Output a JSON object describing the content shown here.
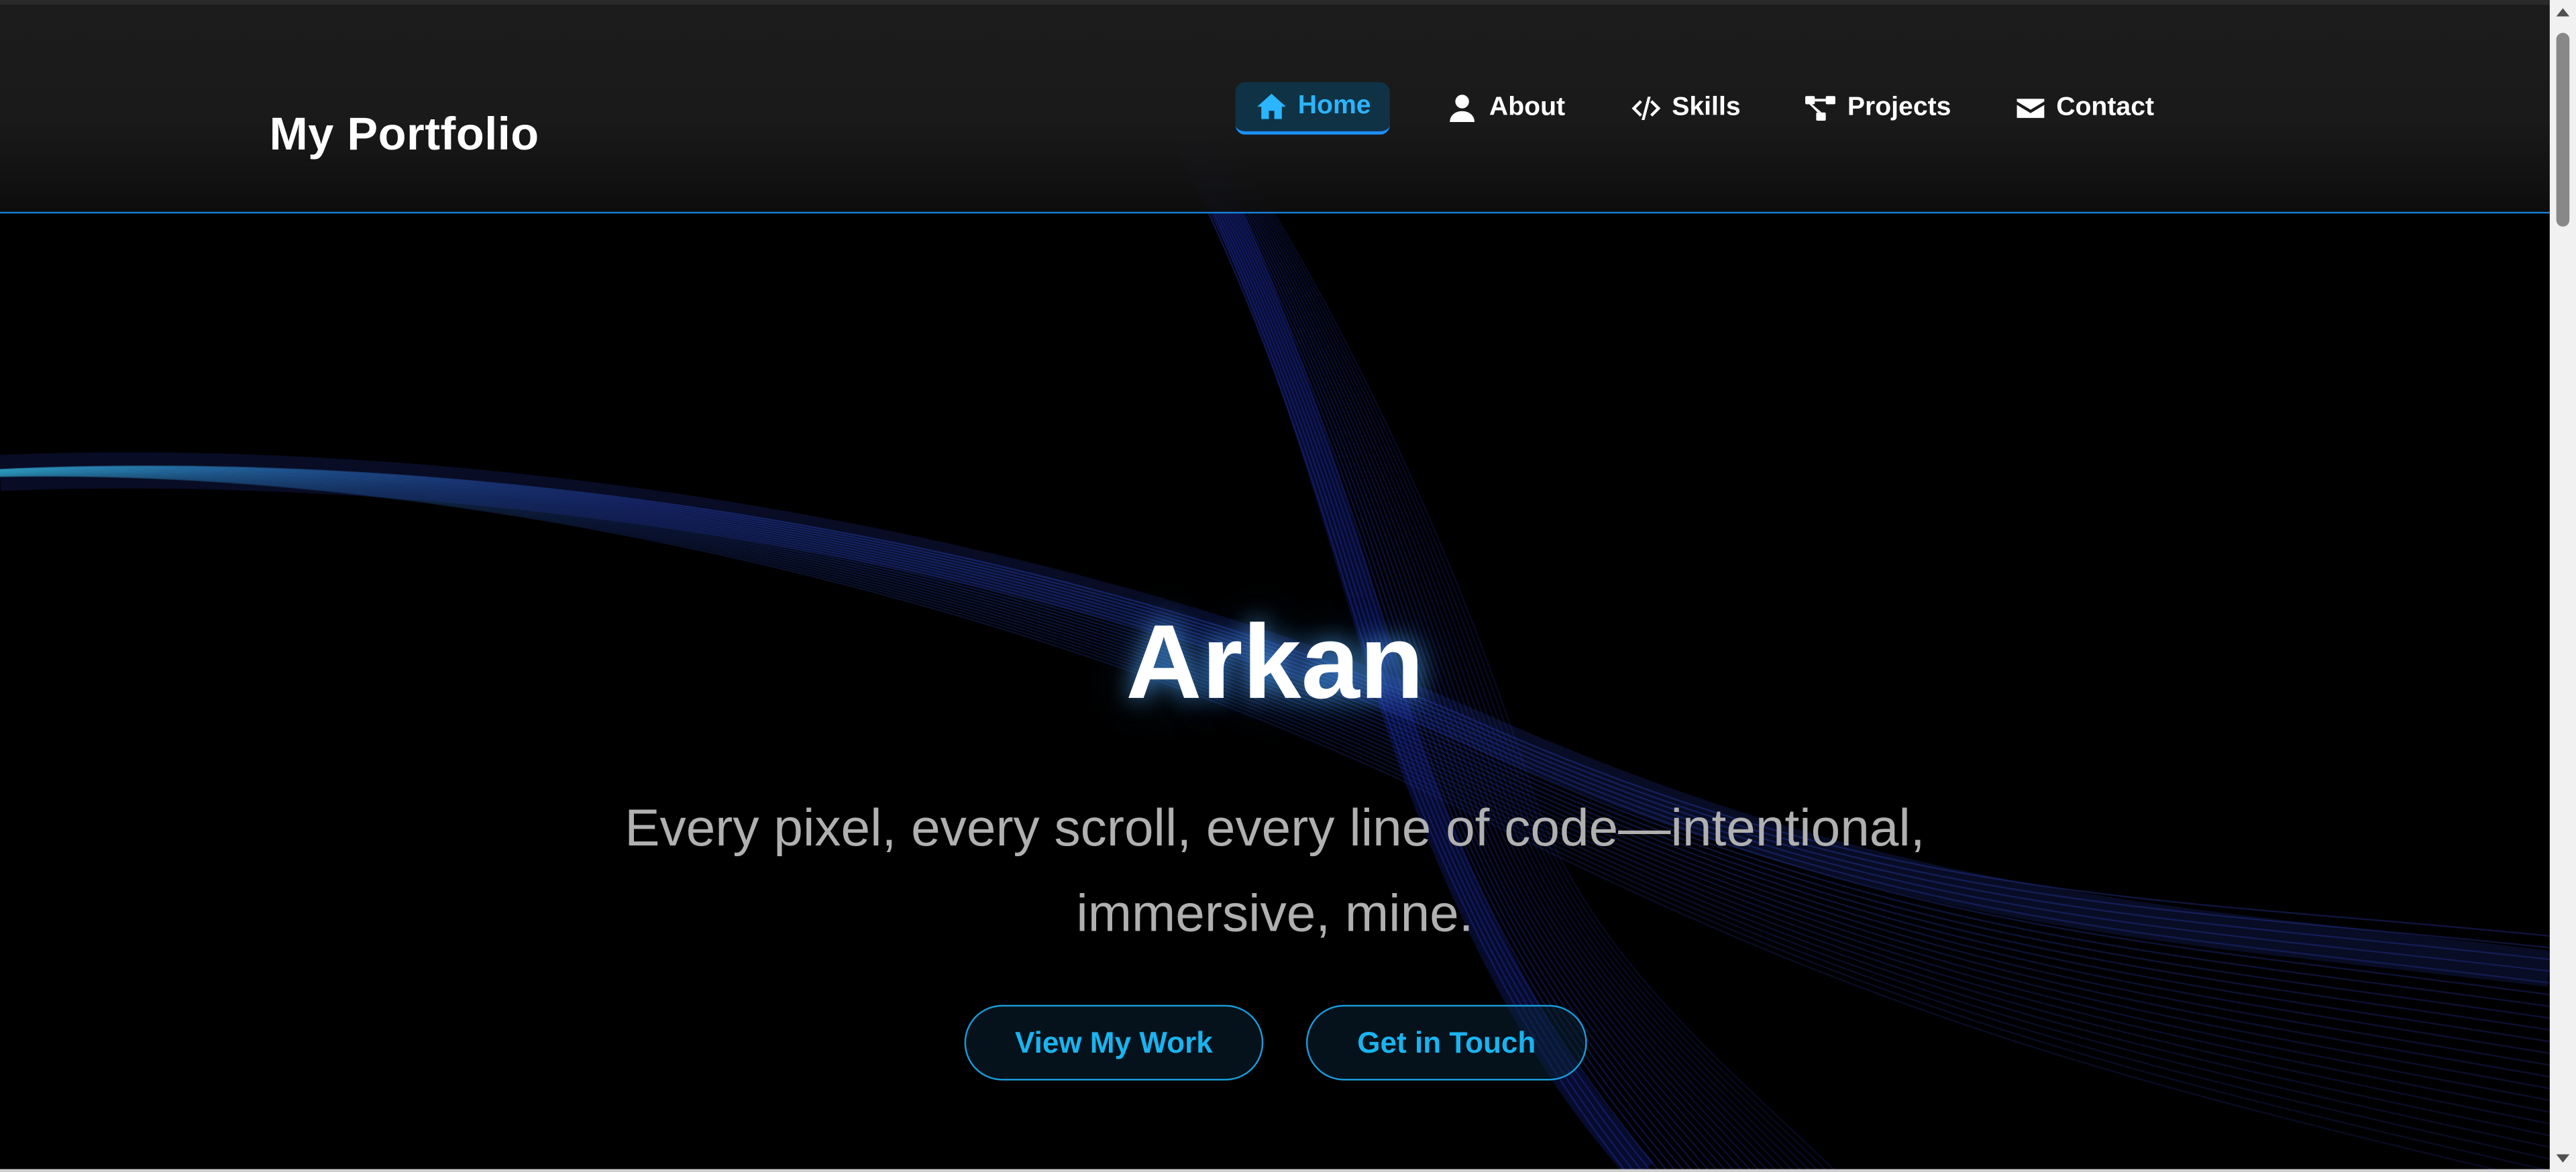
{
  "brand": "My Portfolio",
  "nav": {
    "items": [
      {
        "label": "Home",
        "icon": "home-icon",
        "active": true
      },
      {
        "label": "About",
        "icon": "user-icon",
        "active": false
      },
      {
        "label": "Skills",
        "icon": "code-icon",
        "active": false
      },
      {
        "label": "Projects",
        "icon": "project-diagram-icon",
        "active": false
      },
      {
        "label": "Contact",
        "icon": "envelope-icon",
        "active": false
      }
    ]
  },
  "hero": {
    "title": "Arkan",
    "subtitle": "Every pixel, every scroll, every line of code—intentional, immersive, mine.",
    "buttons": {
      "view_work": "View My Work",
      "get_in_touch": "Get in Touch"
    }
  },
  "colors": {
    "accent": "#1e90ff",
    "button_text": "#19b4f0",
    "background": "#000000",
    "navbar": "#1a1a1a",
    "wave": "#2a3cc8"
  }
}
